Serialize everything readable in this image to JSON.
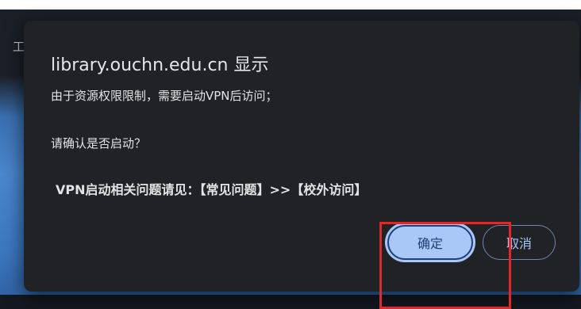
{
  "background": {
    "edge_text": "工"
  },
  "dialog": {
    "title": "library.ouchn.edu.cn 显示",
    "line1": "由于资源权限限制，需要启动VPN后访问；",
    "line2": "请确认是否启动？",
    "line3": "VPN启动相关问题请见：【常见问题】>>【校外访问】",
    "ok_label": "确定",
    "cancel_label": "取消"
  },
  "colors": {
    "dialog_bg": "#212226",
    "button_accent": "#a9c7f7",
    "highlight_box": "#e0282a"
  }
}
